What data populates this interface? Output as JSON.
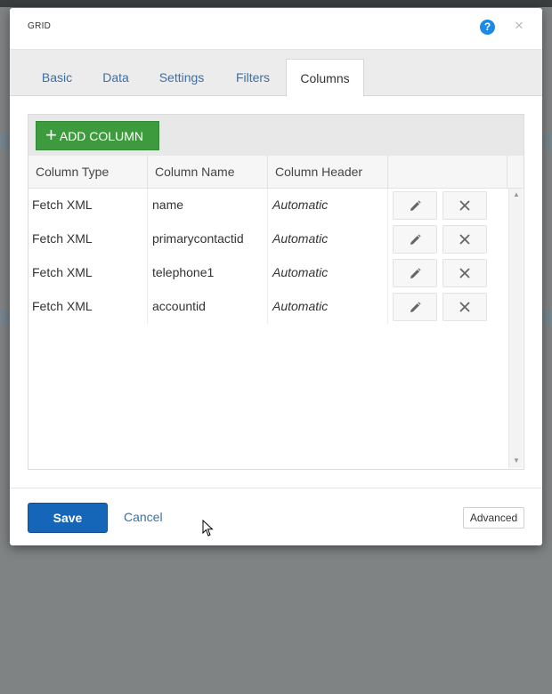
{
  "dialog": {
    "title": "GRID",
    "help_icon": "?",
    "close_icon": "×"
  },
  "tabs": [
    {
      "label": "Basic",
      "active": false
    },
    {
      "label": "Data",
      "active": false
    },
    {
      "label": "Settings",
      "active": false
    },
    {
      "label": "Filters",
      "active": false
    },
    {
      "label": "Columns",
      "active": true
    }
  ],
  "toolbar": {
    "add_icon": "+",
    "add_label": "ADD COLUMN"
  },
  "grid": {
    "headers": [
      "Column Type",
      "Column Name",
      "Column Header",
      ""
    ],
    "rows": [
      {
        "type": "Fetch XML",
        "name": "name",
        "header": "Automatic"
      },
      {
        "type": "Fetch XML",
        "name": "primarycontactid",
        "header": "Automatic"
      },
      {
        "type": "Fetch XML",
        "name": "telephone1",
        "header": "Automatic"
      },
      {
        "type": "Fetch XML",
        "name": "accountid",
        "header": "Automatic"
      }
    ],
    "row_actions": [
      "pencil-icon",
      "x-icon"
    ]
  },
  "footer": {
    "save_label": "Save",
    "cancel_label": "Cancel",
    "advanced_label": "Advanced"
  },
  "colors": {
    "accent": "#1565b8",
    "add_button": "#3d9a3d",
    "link": "#3c6fa5"
  }
}
